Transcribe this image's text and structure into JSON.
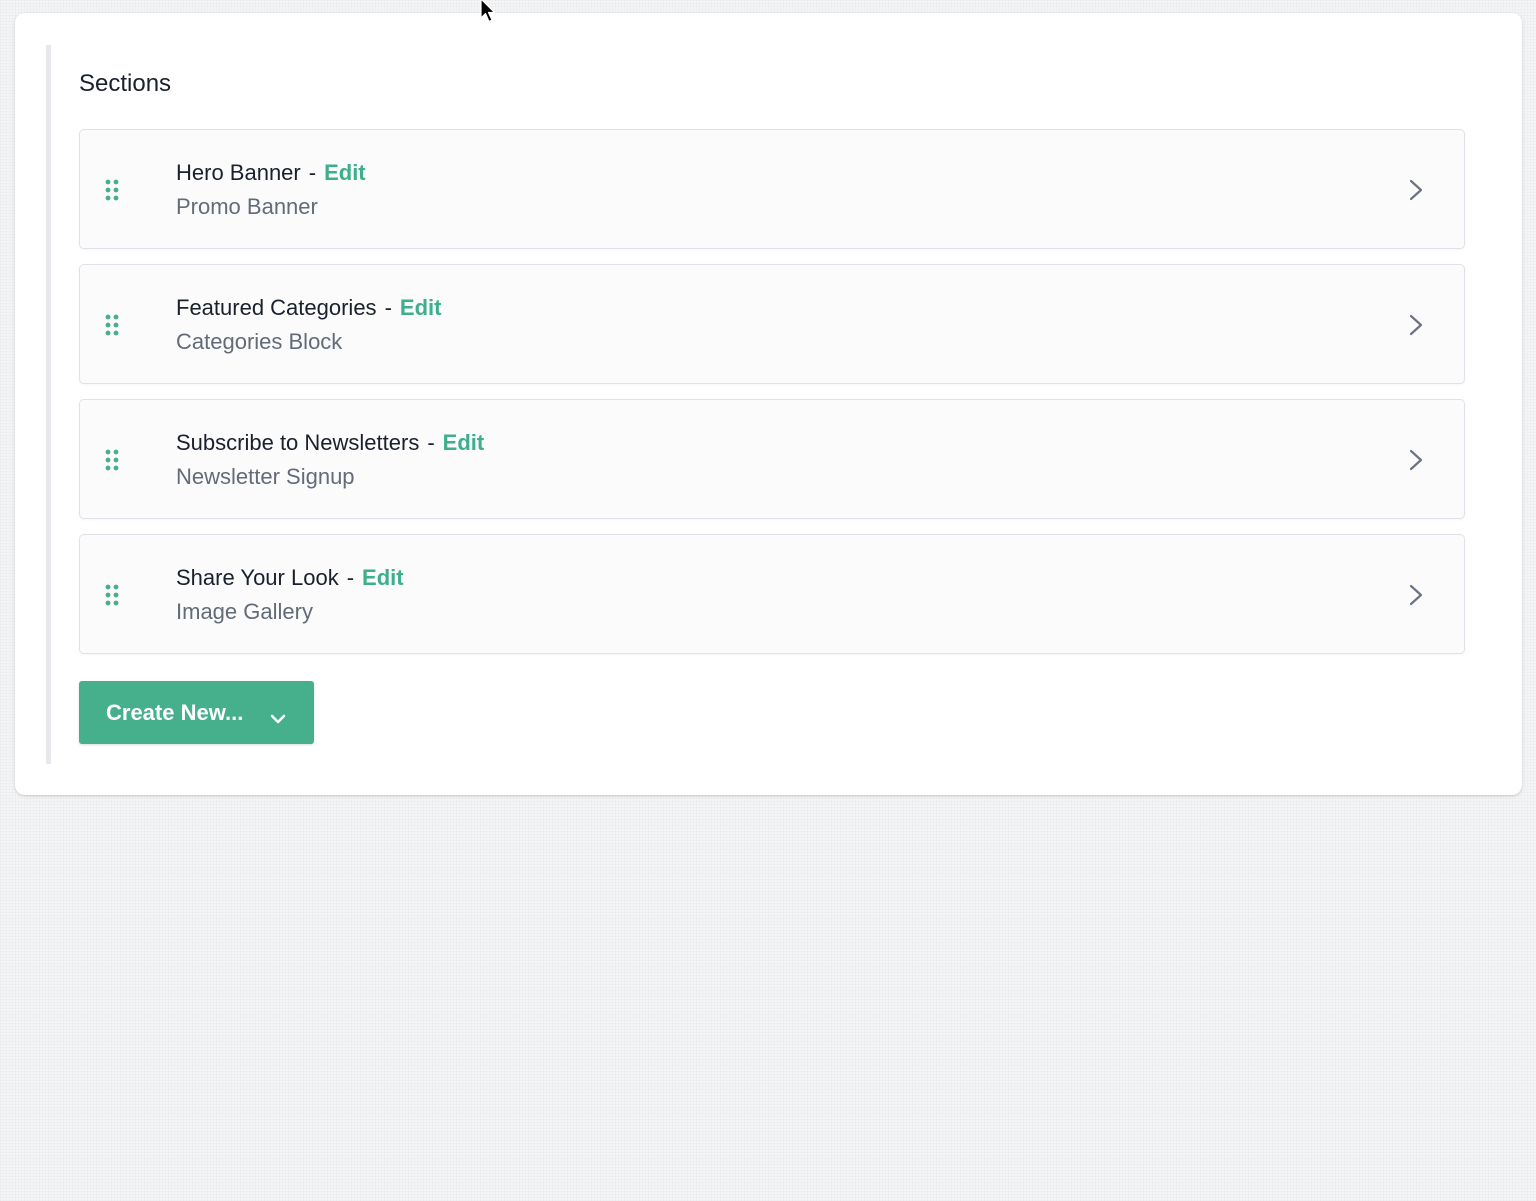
{
  "colors": {
    "accent": "#46b08c",
    "edit_link": "#3eaf8c",
    "title_text": "#1a202c",
    "subtitle_text": "#636b78",
    "page_background": "#f4f5f6"
  },
  "panel": {
    "title": "Sections"
  },
  "sections": [
    {
      "title": "Hero Banner",
      "separator": "-",
      "edit_label": "Edit",
      "type": "Promo Banner",
      "handle_icon": "drag-handle-icon",
      "action_icon": "chevron-right-icon"
    },
    {
      "title": "Featured Categories",
      "separator": "-",
      "edit_label": "Edit",
      "type": "Categories Block",
      "handle_icon": "drag-handle-icon",
      "action_icon": "chevron-right-icon"
    },
    {
      "title": "Subscribe to Newsletters",
      "separator": "-",
      "edit_label": "Edit",
      "type": "Newsletter Signup",
      "handle_icon": "drag-handle-icon",
      "action_icon": "chevron-right-icon"
    },
    {
      "title": "Share Your Look",
      "separator": "-",
      "edit_label": "Edit",
      "type": "Image Gallery",
      "handle_icon": "drag-handle-icon",
      "action_icon": "chevron-right-icon"
    }
  ],
  "create_button": {
    "label": "Create New...",
    "icon": "chevron-down-icon"
  }
}
